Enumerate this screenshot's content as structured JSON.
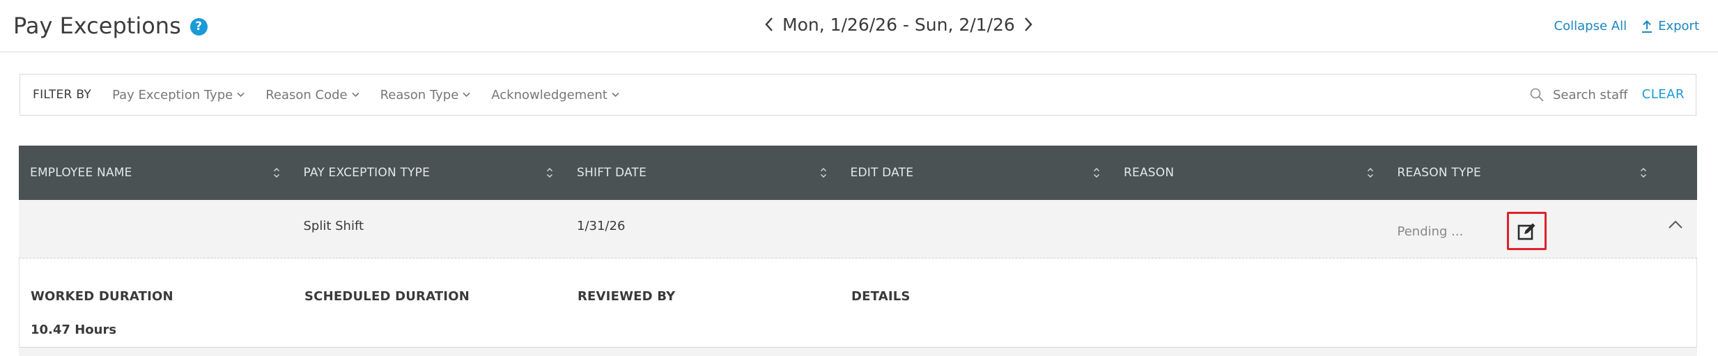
{
  "header": {
    "title": "Pay Exceptions",
    "help_glyph": "?",
    "date_range": "Mon, 1/26/26 - Sun, 2/1/26",
    "collapse_all": "Collapse All",
    "export": "Export"
  },
  "filters": {
    "label": "FILTER BY",
    "items": [
      "Pay Exception Type",
      "Reason Code",
      "Reason Type",
      "Acknowledgement"
    ],
    "search_placeholder": "Search staff",
    "clear": "CLEAR"
  },
  "table": {
    "columns": [
      "EMPLOYEE NAME",
      "PAY EXCEPTION TYPE",
      "SHIFT DATE",
      "EDIT DATE",
      "REASON",
      "REASON TYPE"
    ],
    "row": {
      "employee_name": "",
      "pay_exception_type": "Split Shift",
      "shift_date": "1/31/26",
      "edit_date": "",
      "reason": "",
      "reason_type": "Pending ..."
    },
    "details": {
      "headers": [
        "WORKED DURATION",
        "SCHEDULED DURATION",
        "REVIEWED BY",
        "DETAILS"
      ],
      "worked_duration": "10.47 Hours"
    }
  },
  "colors": {
    "accent": "#1a9ad6",
    "header_bg": "#4a5254",
    "highlight": "#e1202a"
  }
}
